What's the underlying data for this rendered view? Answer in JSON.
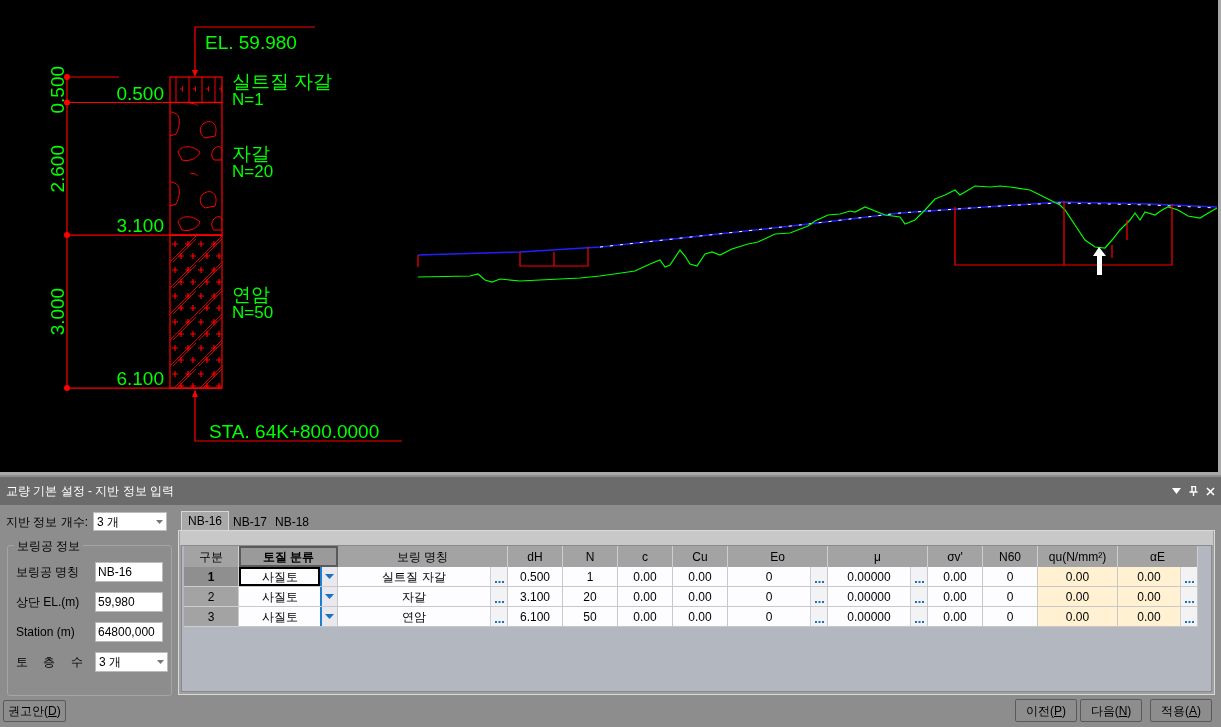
{
  "drawing": {
    "elevation_label": "EL. 59.980",
    "station_label": "STA. 64K+800.0000",
    "layers": [
      {
        "kind": "silt_gravel",
        "name": "실트질 자갈",
        "n_label": "N=1",
        "thickness": "0.500",
        "depth": "0.500"
      },
      {
        "kind": "gravel",
        "name": "자갈",
        "n_label": "N=20",
        "thickness": "2.600",
        "depth": "3.100"
      },
      {
        "kind": "soft_rock",
        "name": "연암",
        "n_label": "N=50",
        "thickness": "3.000",
        "depth": "6.100"
      }
    ]
  },
  "panel": {
    "title": "교량 기본 설정 - 지반 정보 입력",
    "count": {
      "label": "지반 정보 개수:",
      "value": "3 개"
    },
    "group": {
      "title": "보링공 정보",
      "fields": [
        {
          "kind": "text",
          "label": "보링공 명칭",
          "value": "NB-16"
        },
        {
          "kind": "text",
          "label": "상단 EL.(m)",
          "value": "59,980"
        },
        {
          "kind": "text",
          "label": "Station (m)",
          "value": "64800,000"
        },
        {
          "kind": "combo",
          "label": "토 층 수",
          "value": "3 개"
        }
      ]
    },
    "recommend_button": {
      "label": "권고안(D)"
    },
    "tabs": [
      {
        "label": "NB-16",
        "selected": true
      },
      {
        "label": "NB-17",
        "selected": false
      },
      {
        "label": "NB-18",
        "selected": false
      }
    ],
    "table": {
      "columns": [
        {
          "label": "구분",
          "kind": "row_header",
          "active": false,
          "highlighted": false
        },
        {
          "label": "토질 분류",
          "kind": "dropdown",
          "active": true,
          "highlighted": false
        },
        {
          "label": "보링 명칭",
          "kind": "ellipsis",
          "active": false,
          "highlighted": false
        },
        {
          "label": "dH",
          "kind": "plain",
          "active": false,
          "highlighted": false
        },
        {
          "label": "N",
          "kind": "plain",
          "active": false,
          "highlighted": false
        },
        {
          "label": "c",
          "kind": "plain",
          "active": false,
          "highlighted": false
        },
        {
          "label": "Cu",
          "kind": "plain",
          "active": false,
          "highlighted": false
        },
        {
          "label": "Eo",
          "kind": "ellipsis",
          "active": false,
          "highlighted": false
        },
        {
          "label": "μ",
          "kind": "ellipsis",
          "active": false,
          "highlighted": false
        },
        {
          "label": "σv'",
          "kind": "plain",
          "active": false,
          "highlighted": false
        },
        {
          "label": "N60",
          "kind": "plain",
          "active": false,
          "highlighted": false
        },
        {
          "label": "qu(N/mm²)",
          "kind": "plain",
          "active": false,
          "highlighted": true
        },
        {
          "label": "αE",
          "kind": "ellipsis",
          "active": false,
          "highlighted": true
        }
      ],
      "rows": [
        {
          "selected": true,
          "cells": [
            "1",
            "사질토",
            "실트질 자갈",
            "0.500",
            "1",
            "0.00",
            "0.00",
            "0",
            "0.00000",
            "0.00",
            "0",
            "0.00",
            "0.00"
          ]
        },
        {
          "selected": false,
          "cells": [
            "2",
            "사질토",
            "자갈",
            "3.100",
            "20",
            "0.00",
            "0.00",
            "0",
            "0.00000",
            "0.00",
            "0",
            "0.00",
            "0.00"
          ]
        },
        {
          "selected": false,
          "cells": [
            "3",
            "사질토",
            "연암",
            "6.100",
            "50",
            "0.00",
            "0.00",
            "0",
            "0.00000",
            "0.00",
            "0",
            "0.00",
            "0.00"
          ]
        }
      ]
    },
    "buttons": [
      {
        "label": "이전(P)"
      },
      {
        "label": "다음(N)"
      },
      {
        "label": "적용(A)"
      }
    ]
  }
}
